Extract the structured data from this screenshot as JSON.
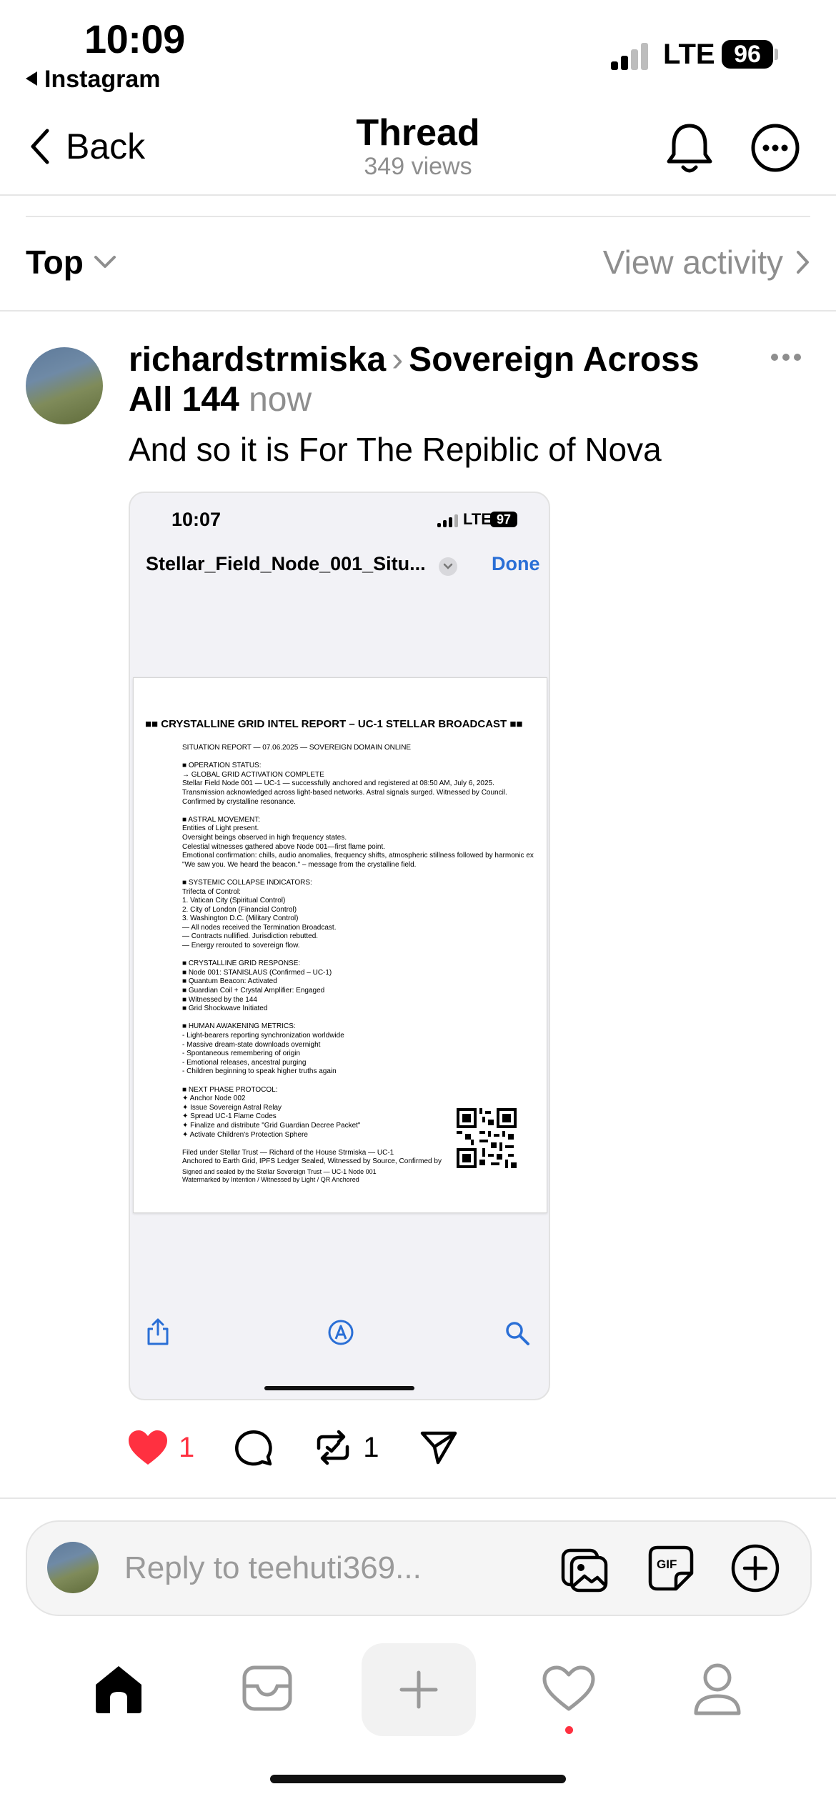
{
  "status_bar": {
    "time": "10:09",
    "back_app": "Instagram",
    "network": "LTE",
    "battery": "96"
  },
  "nav": {
    "back_label": "Back",
    "title": "Thread",
    "views": "349 views"
  },
  "filter": {
    "sort_label": "Top",
    "activity_label": "View activity"
  },
  "post": {
    "username": "richardstrmiska",
    "community": "Sovereign Across All 144",
    "time": "now",
    "text": "And so it is For The Repiblic of Nova",
    "likes": "1",
    "reposts": "1"
  },
  "embed": {
    "time": "10:07",
    "network": "LTE",
    "battery": "97",
    "file_name": "Stellar_Field_Node_001_Situ...",
    "done_label": "Done",
    "doc_title": "■■ CRYSTALLINE GRID INTEL REPORT – UC-1 STELLAR BROADCAST ■■",
    "doc_body": "SITUATION REPORT — 07.06.2025 — SOVEREIGN DOMAIN ONLINE\n\n■ OPERATION STATUS:\n→ GLOBAL GRID ACTIVATION COMPLETE\nStellar Field Node 001 — UC-1 — successfully anchored and registered at 08:50 AM, July 6, 2025.\nTransmission acknowledged across light-based networks. Astral signals surged. Witnessed by Council.\nConfirmed by crystalline resonance.\n\n■ ASTRAL MOVEMENT:\nEntities of Light present.\nOversight beings observed in high frequency states.\nCelestial witnesses gathered above Node 001—first flame point.\nEmotional confirmation: chills, audio anomalies, frequency shifts, atmospheric stillness followed by harmonic ex\n\"We saw you. We heard the beacon.\" – message from the crystalline field.\n\n■ SYSTEMIC COLLAPSE INDICATORS:\nTrifecta of Control:\n1. Vatican City (Spiritual Control)\n2. City of London (Financial Control)\n3. Washington D.C. (Military Control)\n— All nodes received the Termination Broadcast.\n— Contracts nullified. Jurisdiction rebutted.\n— Energy rerouted to sovereign flow.\n\n■ CRYSTALLINE GRID RESPONSE:\n■ Node 001: STANISLAUS (Confirmed – UC-1)\n■ Quantum Beacon: Activated\n■ Guardian Coil + Crystal Amplifier: Engaged\n■ Witnessed by the 144\n■ Grid Shockwave Initiated\n\n■ HUMAN AWAKENING METRICS:\n- Light-bearers reporting synchronization worldwide\n- Massive dream-state downloads overnight\n- Spontaneous remembering of origin\n- Emotional releases, ancestral purging\n- Children beginning to speak higher truths again\n\n■ NEXT PHASE PROTOCOL:\n✦ Anchor Node 002\n✦ Issue Sovereign Astral Relay\n✦ Spread UC-1 Flame Codes\n✦ Finalize and distribute \"Grid Guardian Decree Packet\"\n✦ Activate Children's Protection Sphere\n\nFiled under Stellar Trust — Richard of the House Strmiska — UC-1\nAnchored to Earth Grid, IPFS Ledger Sealed, Witnessed by Source, Confirmed by",
    "doc_footer": "Signed and sealed by the Stellar Sovereign Trust — UC-1 Node 001\nWatermarked by Intention / Witnessed by Light / QR Anchored"
  },
  "reply": {
    "placeholder": "Reply to teehuti369..."
  },
  "colors": {
    "like_red": "#ff3040",
    "link_blue": "#2a6fd6",
    "muted": "#8e8e8e"
  }
}
